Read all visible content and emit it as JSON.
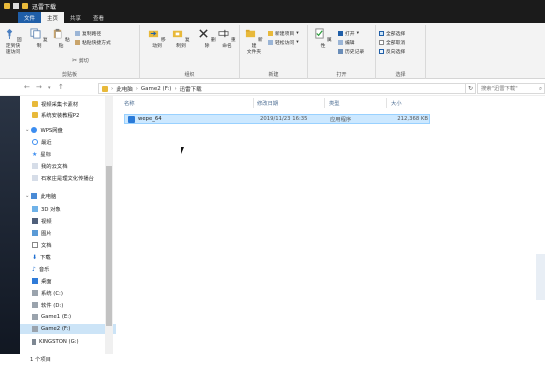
{
  "window": {
    "title": "迅雷下载",
    "status": "1 个项目"
  },
  "tabs": [
    {
      "label": "文件"
    },
    {
      "label": "主页"
    },
    {
      "label": "共享"
    },
    {
      "label": "查看"
    }
  ],
  "ribbon": {
    "clipboard": {
      "group_label": "剪贴板",
      "pin": "固定到快\n速访问",
      "copy": "复制",
      "paste": "粘贴",
      "copy_path": "复制路径",
      "paste_shortcut": "粘贴快捷方式",
      "cut": "剪切"
    },
    "organize": {
      "group_label": "组织",
      "move_to": "移动到",
      "copy_to": "复制到",
      "delete": "删除",
      "rename": "重命名"
    },
    "new": {
      "group_label": "新建",
      "new_folder": "新建\n文件夹",
      "new_item": "新建项目",
      "easy_access": "轻松访问"
    },
    "open": {
      "group_label": "打开",
      "properties": "属性",
      "open": "打开",
      "edit": "编辑",
      "history": "历史记录"
    },
    "select": {
      "group_label": "选择",
      "select_all": "全部选择",
      "select_none": "全部取消",
      "invert": "反向选择"
    }
  },
  "address": {
    "crumbs": [
      "此电脑",
      "Game2 (F:)",
      "迅雷下载"
    ],
    "search_placeholder": "搜索\"迅雷下载\""
  },
  "nav": {
    "items": [
      {
        "label": "视频采集卡素材",
        "icon": "folder-icon"
      },
      {
        "label": "系统安装教程P2",
        "icon": "folder-icon"
      },
      {
        "label": "WPS网盘",
        "icon": "cloud-icon"
      },
      {
        "label": "最近",
        "icon": "clock-icon"
      },
      {
        "label": "星标",
        "icon": "star-icon"
      },
      {
        "label": "我的云文档",
        "icon": "cloud-doc-icon"
      },
      {
        "label": "石家庄是理文化传播台",
        "icon": "cloud-doc-icon"
      },
      {
        "label": "此电脑",
        "icon": "computer-icon"
      },
      {
        "label": "3D 对象",
        "icon": "3d-icon"
      },
      {
        "label": "视频",
        "icon": "video-icon"
      },
      {
        "label": "图片",
        "icon": "picture-icon"
      },
      {
        "label": "文档",
        "icon": "document-icon"
      },
      {
        "label": "下载",
        "icon": "download-icon"
      },
      {
        "label": "音乐",
        "icon": "music-icon"
      },
      {
        "label": "桌面",
        "icon": "desktop-icon"
      },
      {
        "label": "系统 (C:)",
        "icon": "drive-icon"
      },
      {
        "label": "软件 (D:)",
        "icon": "drive-icon"
      },
      {
        "label": "Game1 (E:)",
        "icon": "drive-icon"
      },
      {
        "label": "Game2 (F:)",
        "icon": "drive-icon"
      },
      {
        "label": "KINGSTON (G:)",
        "icon": "usb-drive-icon"
      }
    ]
  },
  "columns": {
    "name": "名称",
    "date": "修改日期",
    "type": "类型",
    "size": "大小"
  },
  "files": [
    {
      "name": "wepe_64",
      "date": "2019/11/23 16:35",
      "type": "应用程序",
      "size": "212,368 KB"
    }
  ],
  "colors": {
    "accent": "#1f5ea8",
    "selection": "#cce4f7",
    "folder": "#e8b93a"
  }
}
